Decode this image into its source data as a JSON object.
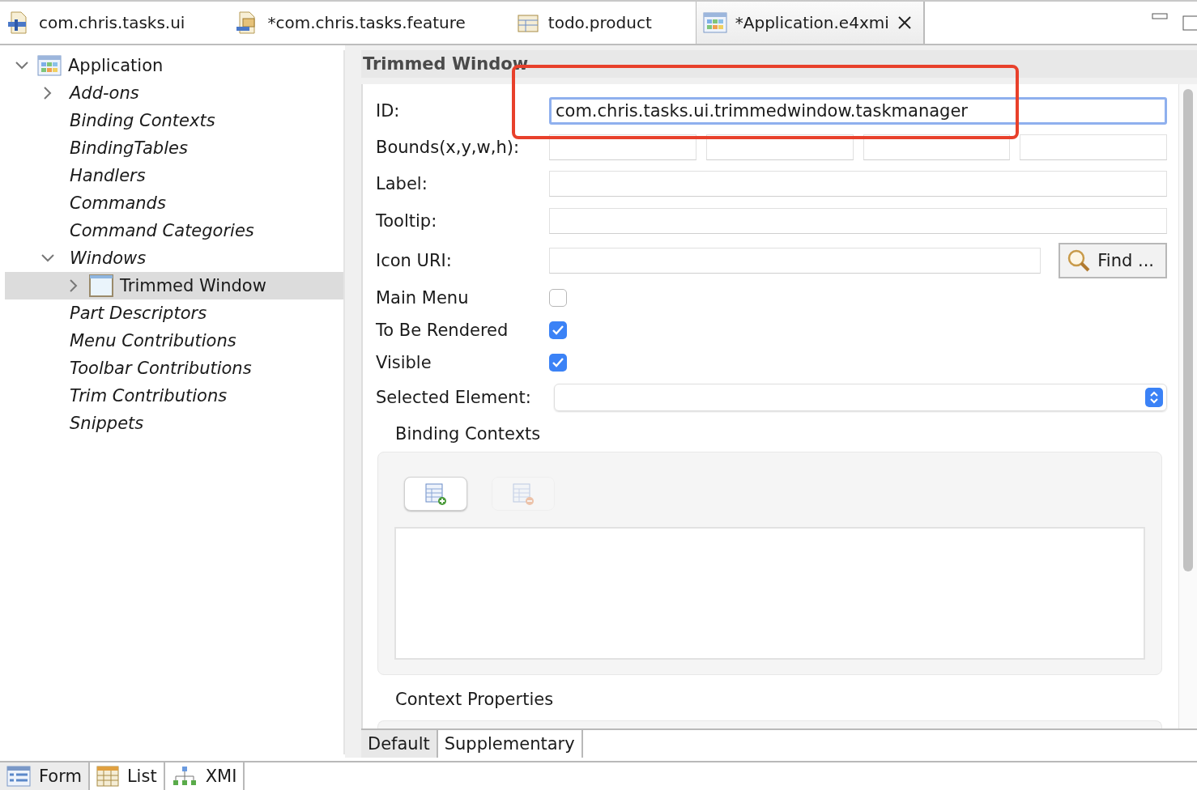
{
  "editor_tabs": [
    {
      "label": "com.chris.tasks.ui",
      "kind": "plugin",
      "selected": false,
      "dirty_close": false
    },
    {
      "label": "*com.chris.tasks.feature",
      "kind": "feature",
      "selected": false,
      "dirty_close": false
    },
    {
      "label": "todo.product",
      "kind": "product",
      "selected": false,
      "dirty_close": false
    },
    {
      "label": "*Application.e4xmi",
      "kind": "app",
      "selected": true,
      "dirty_close": true
    }
  ],
  "tree": [
    {
      "label": "Application",
      "kind": "app",
      "expanded": true,
      "selected": false,
      "children": [
        {
          "label": "Add-ons",
          "kind": "folder",
          "expanded": false,
          "selected": false
        },
        {
          "label": "Binding Contexts",
          "kind": "folder",
          "selected": false
        },
        {
          "label": "BindingTables",
          "kind": "folder",
          "selected": false
        },
        {
          "label": "Handlers",
          "kind": "folder",
          "selected": false
        },
        {
          "label": "Commands",
          "kind": "folder",
          "selected": false
        },
        {
          "label": "Command Categories",
          "kind": "folder",
          "selected": false
        },
        {
          "label": "Windows",
          "kind": "folder",
          "expanded": true,
          "selected": false,
          "children": [
            {
              "label": "Trimmed Window",
              "kind": "window",
              "expanded": false,
              "selected": true
            }
          ]
        },
        {
          "label": "Part Descriptors",
          "kind": "folder",
          "selected": false
        },
        {
          "label": "Menu Contributions",
          "kind": "folder",
          "selected": false
        },
        {
          "label": "Toolbar Contributions",
          "kind": "folder",
          "selected": false
        },
        {
          "label": "Trim Contributions",
          "kind": "folder",
          "selected": false
        },
        {
          "label": "Snippets",
          "kind": "folder",
          "selected": false
        }
      ]
    }
  ],
  "form": {
    "title": "Trimmed Window",
    "fields": [
      {
        "kind": "text",
        "label": "ID:",
        "value": "com.chris.tasks.ui.trimmedwindow.taskmanager",
        "highlighted": true
      },
      {
        "kind": "bounds",
        "label": "Bounds(x,y,w,h):"
      },
      {
        "kind": "text",
        "label": "Label:",
        "highlighted": false
      },
      {
        "kind": "text",
        "label": "Tooltip:",
        "highlighted": false
      },
      {
        "kind": "uri",
        "label": "Icon URI:",
        "button": "Find ..."
      },
      {
        "kind": "checkbox",
        "label": "Main Menu",
        "checked": false
      },
      {
        "kind": "checkbox",
        "label": "To Be Rendered",
        "checked": true
      },
      {
        "kind": "checkbox",
        "label": "Visible",
        "checked": true
      },
      {
        "kind": "select",
        "label": "Selected Element:"
      }
    ],
    "binding_contexts": {
      "title": "Binding Contexts",
      "add_disabled": false,
      "remove_disabled": true
    },
    "context_properties": {
      "title": "Context Properties"
    }
  },
  "inner_tabs": [
    {
      "label": "Default",
      "selected": true
    },
    {
      "label": "Supplementary",
      "selected": false
    }
  ],
  "outer_tabs": [
    {
      "label": "Form",
      "kind": "form",
      "selected": true
    },
    {
      "label": "List",
      "kind": "list",
      "selected": false
    },
    {
      "label": "XMI",
      "kind": "xmi",
      "selected": false
    }
  ]
}
